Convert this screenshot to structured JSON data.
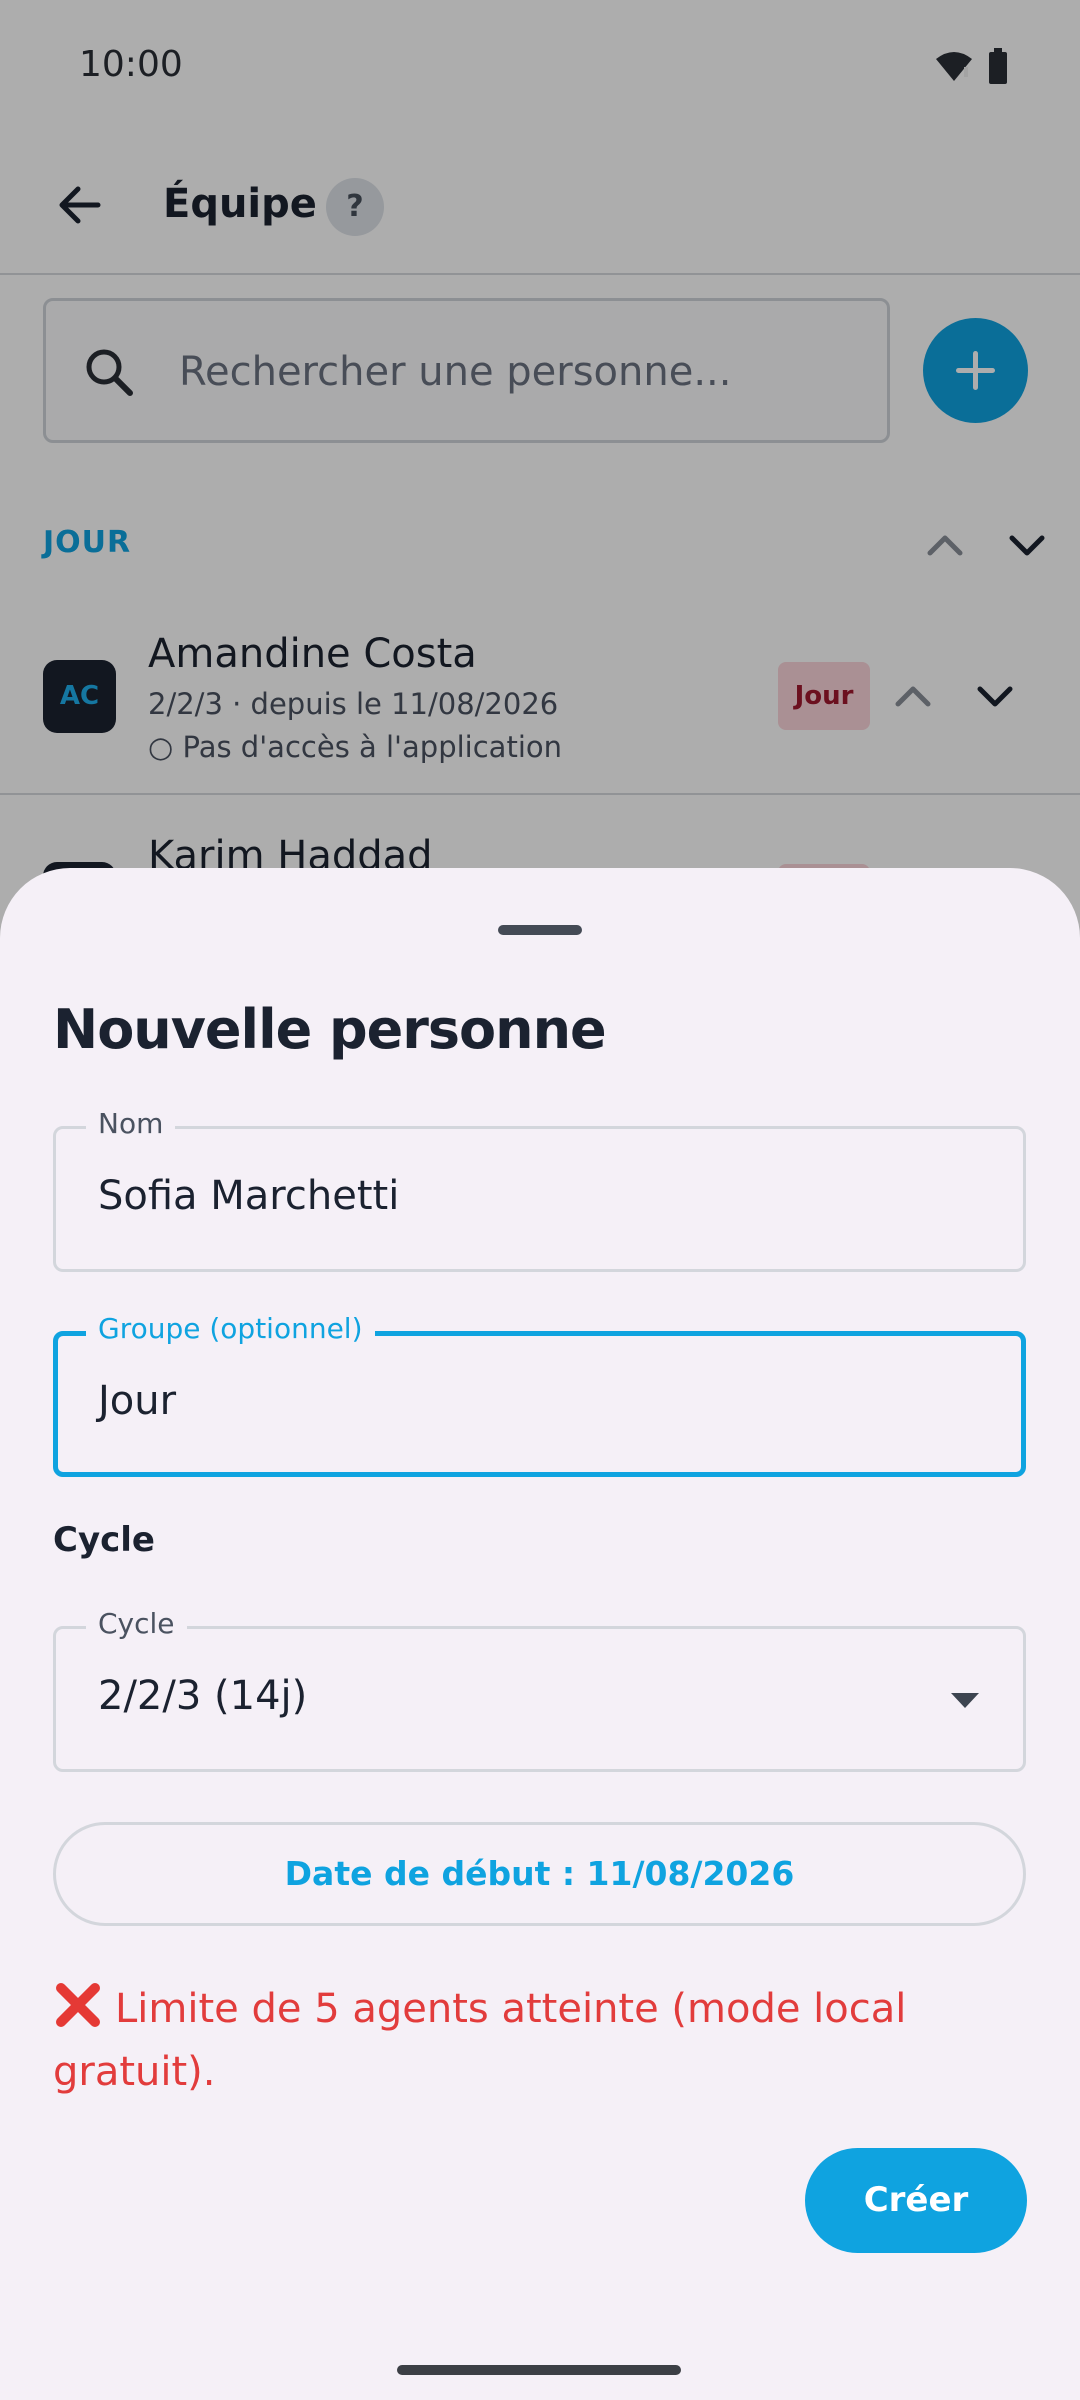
{
  "status_bar": {
    "time": "10:00"
  },
  "header": {
    "title": "Équipe",
    "help_label": "?"
  },
  "search": {
    "placeholder": "Rechercher une personne..."
  },
  "group": {
    "name": "JOUR"
  },
  "people": [
    {
      "initials": "AC",
      "name": "Amandine Costa",
      "cycle_info": "2/2/3 · depuis le 11/08/2026",
      "access_info": "○ Pas d'accès à l'application",
      "badge": "Jour"
    },
    {
      "name": "Karim Haddad"
    }
  ],
  "sheet": {
    "title": "Nouvelle personne",
    "name_field": {
      "label": "Nom",
      "value": "Sofia Marchetti"
    },
    "group_field": {
      "label": "Groupe (optionnel)",
      "value": "Jour"
    },
    "cycle_section_title": "Cycle",
    "cycle_field": {
      "label": "Cycle",
      "value": "2/2/3 (14j)"
    },
    "start_date_button": "Date de début : 11/08/2026",
    "error_message": "Limite de 5 agents atteinte (mode local gratuit).",
    "create_button": "Créer"
  },
  "colors": {
    "accent": "#0fa3e0",
    "error": "#e23c3c",
    "badge_bg": "#fbd5da",
    "sheet_bg": "#f5f0f7"
  },
  "icons": [
    "wifi-icon",
    "battery-icon",
    "back-arrow-icon",
    "search-icon",
    "add-icon",
    "chevron-up-icon",
    "chevron-down-icon",
    "error-x-icon",
    "dropdown-arrow-icon"
  ]
}
